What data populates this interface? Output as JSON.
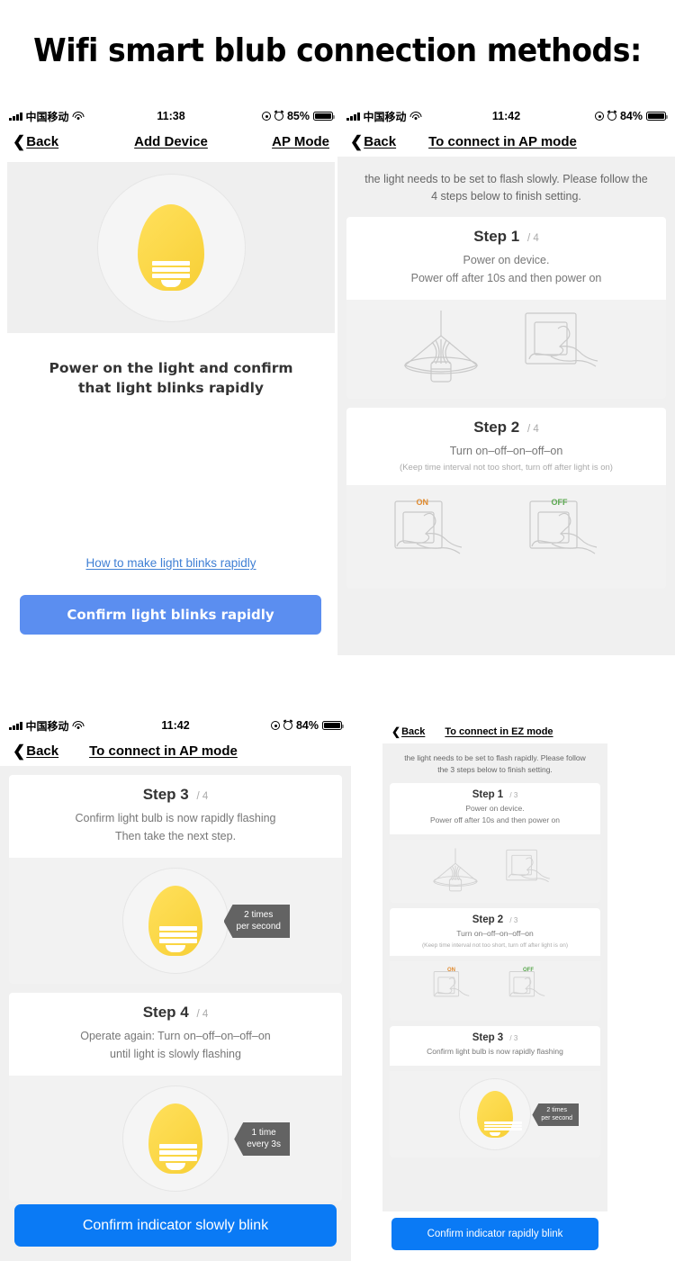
{
  "title": "Wifi smart blub connection methods:",
  "panel1": {
    "status": {
      "carrier": "中国移动",
      "time": "11:38",
      "battery": "85%"
    },
    "nav": {
      "back": "Back",
      "title": "Add Device",
      "right": "AP Mode"
    },
    "caption_line1": "Power on the light and confirm",
    "caption_line2": "that light blinks  rapidly",
    "link": "How to make light blinks rapidly",
    "button": "Confirm light blinks rapidly"
  },
  "panel2": {
    "status": {
      "carrier": "中国移动",
      "time": "11:42",
      "battery": "84%"
    },
    "nav": {
      "back": "Back",
      "title": "To connect in AP mode"
    },
    "intro": "the light needs to be set to flash slowly. Please follow the 4 steps below to finish setting.",
    "steps": [
      {
        "heading": "Step 1",
        "counter": "/ 4",
        "desc_line1": "Power on device.",
        "desc_line2": "Power off after 10s and then power on",
        "note": "",
        "illustration": "lamp-and-switch"
      },
      {
        "heading": "Step 2",
        "counter": "/ 4",
        "desc_line1": "Turn on–off–on–off–on",
        "desc_line2": "",
        "note": "(Keep time interval not too short, turn off after light is on)",
        "illustration": "switch-on-off",
        "on_label": "ON",
        "off_label": "OFF"
      }
    ]
  },
  "panel3": {
    "status": {
      "carrier": "中国移动",
      "time": "11:42",
      "battery": "84%"
    },
    "nav": {
      "back": "Back",
      "title": "To connect in AP mode"
    },
    "steps": [
      {
        "heading": "Step 3",
        "counter": "/ 4",
        "desc_line1": "Confirm light bulb is now rapidly flashing",
        "desc_line2": "Then take the next step.",
        "badge_line1": "2 times",
        "badge_line2": "per second"
      },
      {
        "heading": "Step 4",
        "counter": "/ 4",
        "desc_line1": "Operate again: Turn on–off–on–off–on",
        "desc_line2": "until light is slowly flashing",
        "badge_line1": "1 time",
        "badge_line2": "every 3s"
      }
    ],
    "button": "Confirm indicator slowly blink"
  },
  "panel4": {
    "nav": {
      "back": "Back",
      "title": "To connect in EZ mode"
    },
    "intro": "the light needs to be set to flash rapidly. Please follow the 3 steps below to finish setting.",
    "steps": [
      {
        "heading": "Step 1",
        "counter": "/ 3",
        "desc_line1": "Power on device.",
        "desc_line2": "Power off after 10s and then power on",
        "note": ""
      },
      {
        "heading": "Step 2",
        "counter": "/ 3",
        "desc_line1": "Turn on–off–on–off–on",
        "desc_line2": "",
        "note": "(Keep time interval not too short, turn off after light is on)",
        "on_label": "ON",
        "off_label": "OFF"
      },
      {
        "heading": "Step 3",
        "counter": "/ 3",
        "desc_line1": "Confirm light bulb is now rapidly flashing",
        "desc_line2": "",
        "badge_line1": "2 times",
        "badge_line2": "per second"
      }
    ],
    "button": "Confirm indicator rapidly blink"
  },
  "colors": {
    "primary_button": "#0a7af5",
    "soft_button": "#5b8ef0",
    "link": "#3f7fd4",
    "bulb": "#fcd94b",
    "badge": "#636363",
    "on_label": "#e08a2e",
    "off_label": "#5aa84f"
  }
}
